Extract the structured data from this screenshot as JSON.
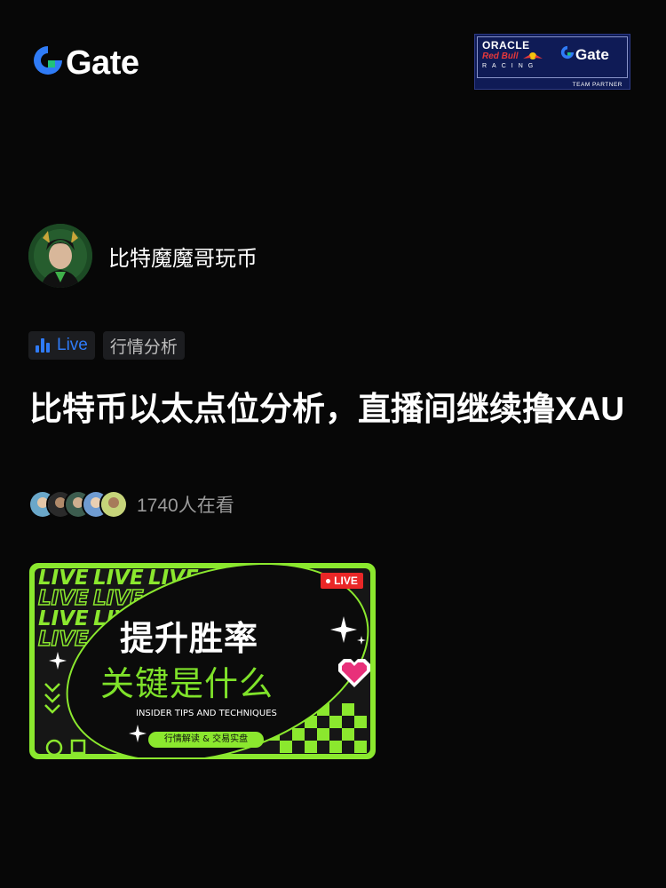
{
  "brand": {
    "name": "Gate",
    "logo_icon": "gate-logo-icon"
  },
  "partner_badge": {
    "oracle": "ORACLE",
    "red_bull": "Red Bull",
    "racing": "RACING",
    "gate": "Gate",
    "caption": "TEAM PARTNER"
  },
  "author": {
    "name": "比特魔魔哥玩币"
  },
  "tags": {
    "live_label": "Live",
    "category": "行情分析"
  },
  "post": {
    "title": "比特币以太点位分析，直播间继续撸XAU"
  },
  "viewers": {
    "count_text": "1740人在看"
  },
  "thumbnail": {
    "line1": "提升胜率",
    "line2": "关键是什么",
    "line3": "INSIDER TIPS AND TECHNIQUES",
    "pill": "行情解读 & 交易实盘",
    "live_badge": "LIVE",
    "bg_word": "LIVE"
  },
  "colors": {
    "accent_blue": "#2f7bf6",
    "live_red": "#ea2727",
    "neon_green": "#8be82e"
  }
}
